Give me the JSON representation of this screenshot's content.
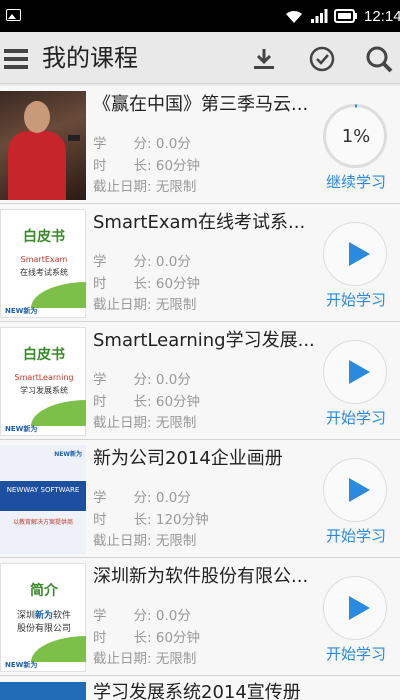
{
  "status_bar": {
    "time": "12:14"
  },
  "header": {
    "title": "我的课程"
  },
  "labels": {
    "score_key": "学　　分:",
    "duration_key": "时　　长:",
    "deadline_key": "截止日期:"
  },
  "courses": [
    {
      "title": "《赢在中国》第三季马云...",
      "score": "0.0分",
      "duration": "60分钟",
      "deadline": "无限制",
      "progress": "1%",
      "action": "继续学习"
    },
    {
      "title": "SmartExam在线考试系...",
      "score": "0.0分",
      "duration": "60分钟",
      "deadline": "无限制",
      "action": "开始学习",
      "cover": {
        "title": "白皮书",
        "line1": "SmartExam",
        "line2": "在线考试系统",
        "brand": "NEW新为"
      }
    },
    {
      "title": "SmartLearning学习发展...",
      "score": "0.0分",
      "duration": "60分钟",
      "deadline": "无限制",
      "action": "开始学习",
      "cover": {
        "title": "白皮书",
        "line1": "SmartLearning",
        "line2": "学习发展系统",
        "brand": "NEW新为"
      }
    },
    {
      "title": "新为公司2014企业画册",
      "score": "0.0分",
      "duration": "120分钟",
      "deadline": "无限制",
      "action": "开始学习",
      "cover": {
        "band": "NEWWAY SOFTWARE",
        "small": "以教育解决方案提供商",
        "brand": "NEW新为"
      }
    },
    {
      "title": "深圳新为软件股份有限公...",
      "score": "0.0分",
      "duration": "60分钟",
      "deadline": "无限制",
      "action": "开始学习",
      "cover": {
        "title": "简介",
        "line1a": "深圳",
        "line1b": "新为",
        "line1c": "软件",
        "line2": "股份有限公司",
        "brand": "NEW新为"
      }
    },
    {
      "title": "学习发展系统2014宣传册"
    }
  ],
  "colors": {
    "accent": "#2a8ae0"
  }
}
